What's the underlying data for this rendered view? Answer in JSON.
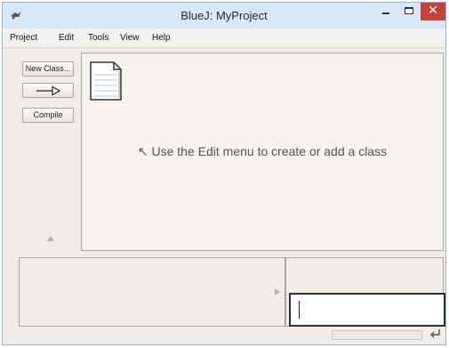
{
  "window": {
    "title": "BlueJ: MyProject",
    "close_glyph": "✕"
  },
  "menu": {
    "items": [
      "Project",
      "Edit",
      "Tools",
      "View",
      "Help"
    ]
  },
  "toolbar": {
    "new_class_label": "New Class...",
    "inherit_arrow_label": "—▷",
    "compile_label": "Compile"
  },
  "diagram": {
    "hint": "↖ Use the Edit menu to create or add a class",
    "readme_icon": "document-icon"
  },
  "icons": {
    "app": "bluej-bird-icon",
    "object_bench_scroll": "right-arrow-icon",
    "left_panel_scroll": "up-arrow-icon",
    "reset": "return-arrow-icon"
  },
  "colors": {
    "title_bar": "#d7e9f8",
    "close_button": "#c7413a",
    "workspace": "#efede6"
  }
}
